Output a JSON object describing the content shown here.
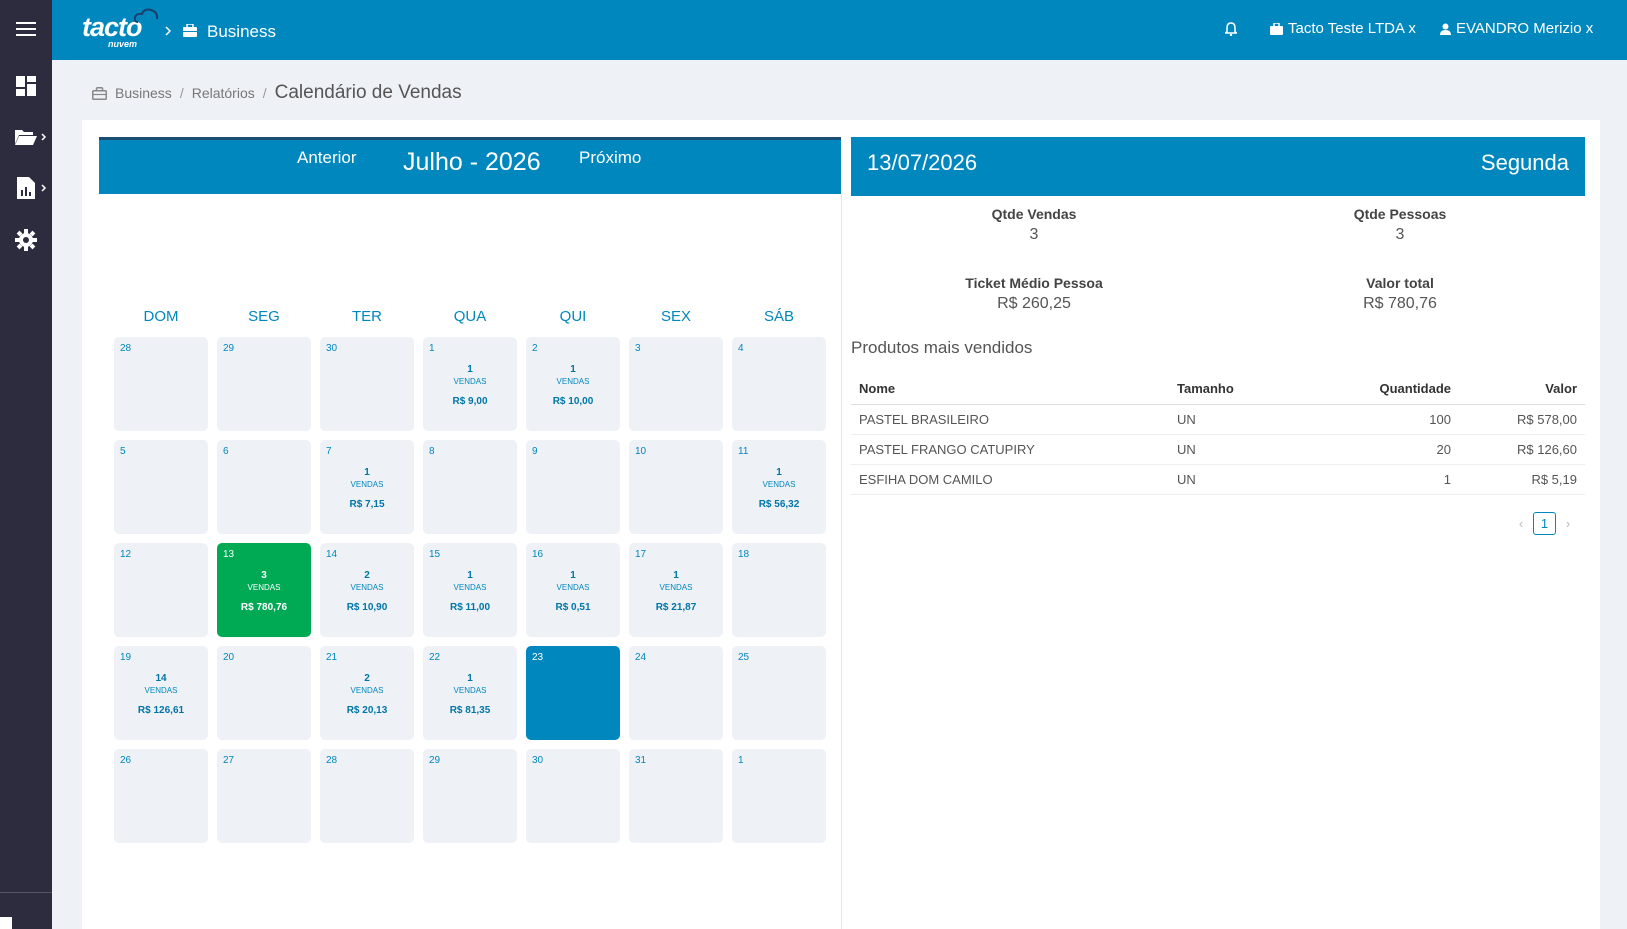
{
  "header": {
    "logo_text": "tacto",
    "logo_sub": "nuvem",
    "app_name": "Business",
    "company": "Tacto Teste LTDA x",
    "user": "EVANDRO Merizio x"
  },
  "breadcrumb": {
    "items": [
      "Business",
      "Relatórios"
    ],
    "current": "Calendário de Vendas"
  },
  "calendar": {
    "prev_label": "Anterior",
    "next_label": "Próximo",
    "month_title": "Julho - 2026",
    "weekdays": [
      "DOM",
      "SEG",
      "TER",
      "QUA",
      "QUI",
      "SEX",
      "SÁB"
    ],
    "days": [
      {
        "num": "28"
      },
      {
        "num": "29"
      },
      {
        "num": "30"
      },
      {
        "num": "1",
        "sales": "1",
        "label": "VENDAS",
        "value": "R$ 9,00"
      },
      {
        "num": "2",
        "sales": "1",
        "label": "VENDAS",
        "value": "R$ 10,00"
      },
      {
        "num": "3"
      },
      {
        "num": "4"
      },
      {
        "num": "5"
      },
      {
        "num": "6"
      },
      {
        "num": "7",
        "sales": "1",
        "label": "VENDAS",
        "value": "R$ 7,15"
      },
      {
        "num": "8"
      },
      {
        "num": "9"
      },
      {
        "num": "10"
      },
      {
        "num": "11",
        "sales": "1",
        "label": "VENDAS",
        "value": "R$ 56,32"
      },
      {
        "num": "12"
      },
      {
        "num": "13",
        "sales": "3",
        "label": "VENDAS",
        "value": "R$ 780,76",
        "state": "selected"
      },
      {
        "num": "14",
        "sales": "2",
        "label": "VENDAS",
        "value": "R$ 10,90"
      },
      {
        "num": "15",
        "sales": "1",
        "label": "VENDAS",
        "value": "R$ 11,00"
      },
      {
        "num": "16",
        "sales": "1",
        "label": "VENDAS",
        "value": "R$ 0,51"
      },
      {
        "num": "17",
        "sales": "1",
        "label": "VENDAS",
        "value": "R$ 21,87"
      },
      {
        "num": "18"
      },
      {
        "num": "19",
        "sales": "14",
        "label": "VENDAS",
        "value": "R$ 126,61"
      },
      {
        "num": "20"
      },
      {
        "num": "21",
        "sales": "2",
        "label": "VENDAS",
        "value": "R$ 20,13"
      },
      {
        "num": "22",
        "sales": "1",
        "label": "VENDAS",
        "value": "R$ 81,35"
      },
      {
        "num": "23",
        "state": "today"
      },
      {
        "num": "24"
      },
      {
        "num": "25"
      },
      {
        "num": "26"
      },
      {
        "num": "27"
      },
      {
        "num": "28"
      },
      {
        "num": "29"
      },
      {
        "num": "30"
      },
      {
        "num": "31"
      },
      {
        "num": "1"
      }
    ]
  },
  "detail": {
    "date": "13/07/2026",
    "weekday": "Segunda",
    "stats": {
      "qtde_vendas": {
        "label": "Qtde Vendas",
        "value": "3"
      },
      "qtde_pessoas": {
        "label": "Qtde Pessoas",
        "value": "3"
      },
      "ticket_medio": {
        "label": "Ticket Médio Pessoa",
        "value": "R$ 260,25"
      },
      "valor_total": {
        "label": "Valor total",
        "value": "R$ 780,76"
      }
    },
    "products_title": "Produtos mais vendidos",
    "table": {
      "headers": [
        "Nome",
        "Tamanho",
        "Quantidade",
        "Valor"
      ],
      "rows": [
        [
          "PASTEL BRASILEIRO",
          "UN",
          "100",
          "R$ 578,00"
        ],
        [
          "PASTEL FRANGO CATUPIRY",
          "UN",
          "20",
          "R$ 126,60"
        ],
        [
          "ESFIHA DOM CAMILO",
          "UN",
          "1",
          "R$ 5,19"
        ]
      ]
    },
    "pagination": {
      "current": "1"
    }
  },
  "colors": {
    "primary": "#0087be",
    "sidebar": "#2d2c3e",
    "selected_day": "#00aa55",
    "day_bg": "#eef1f6"
  }
}
